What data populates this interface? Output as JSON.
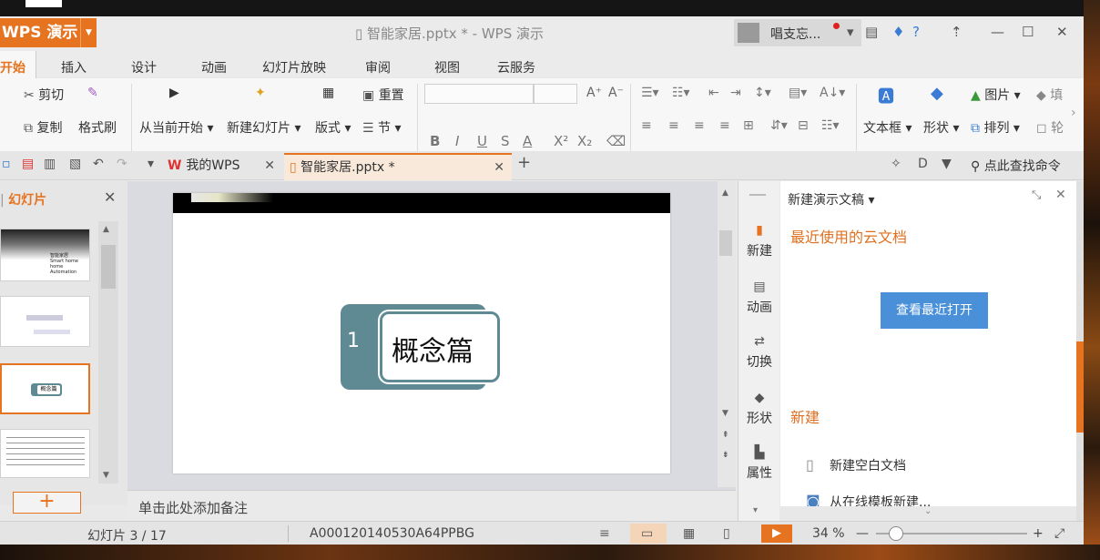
{
  "app": {
    "name": "WPS 演示",
    "window_title": "智能家居.pptx * - WPS 演示",
    "user": "唱支忘..."
  },
  "menu_tabs": [
    "开始",
    "插入",
    "设计",
    "动画",
    "幻灯片放映",
    "审阅",
    "视图",
    "云服务"
  ],
  "ribbon": {
    "cut": "剪切",
    "copy": "复制",
    "format_painter": "格式刷",
    "from_current": "从当前开始",
    "new_slide": "新建幻灯片",
    "layout": "版式",
    "section": "节",
    "reset": "重置",
    "textbox": "文本框",
    "shape": "形状",
    "picture": "图片",
    "arrange": "排列",
    "fill": "填",
    "outline": "轮"
  },
  "doc_tabs": [
    {
      "label": "我的WPS"
    },
    {
      "label": "智能家居.pptx *"
    }
  ],
  "search_command": "点此查找命令",
  "slide_pane": {
    "tab_label": "幻灯片"
  },
  "current_slide": {
    "number": "1",
    "title": "概念篇"
  },
  "notes_placeholder": "单击此处添加备注",
  "side_icons": [
    "新建",
    "动画",
    "切换",
    "形状",
    "属性"
  ],
  "task_pane": {
    "title": "新建演示文稿",
    "recent_header": "最近使用的云文档",
    "view_recent_button": "查看最近打开",
    "new_header": "新建",
    "new_blank": "新建空白文档",
    "new_from_template": "从在线模板新建..."
  },
  "status_bar": {
    "slide_counter": "幻灯片 3 / 17",
    "template_id": "A000120140530A64PPBG",
    "zoom": "34 %"
  },
  "thumbnail_text": {
    "slide1_title": "智能家居",
    "slide1_sub1": "Smart home",
    "slide1_sub2": "home Automation",
    "slide3_title": "概念篇"
  },
  "colors": {
    "accent": "#e5731f",
    "blue": "#4a90d9",
    "card": "#5f8a94"
  }
}
